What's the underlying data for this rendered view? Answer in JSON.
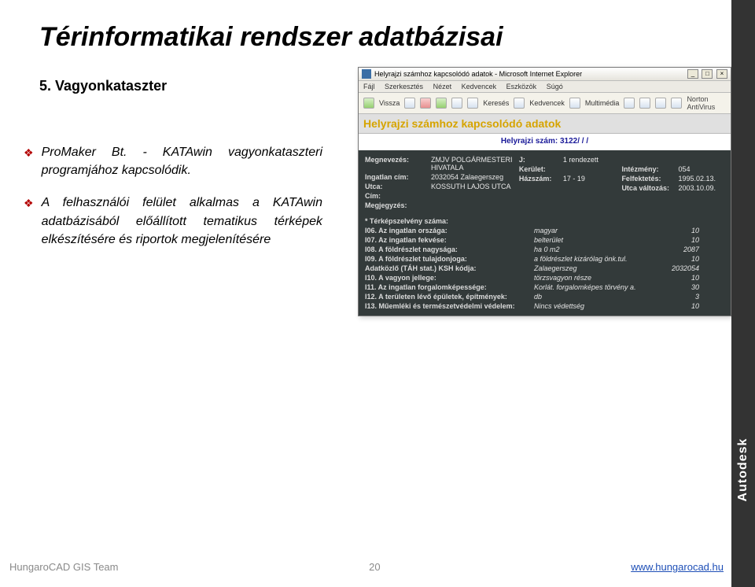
{
  "slide": {
    "title": "Térinformatikai rendszer adatbázisai",
    "subtitle": "5. Vagyonkataszter"
  },
  "bullets": {
    "b1": "ProMaker Bt. - KATAwin vagyonkataszteri programjához kapcsolódik.",
    "b2": "A felhasználói felület alkalmas a KATAwin adatbázisából előállított tematikus térképek elkészítésére és riportok megjelenítésére"
  },
  "browser": {
    "title": "Helyrajzi számhoz kapcsolódó adatok - Microsoft Internet Explorer",
    "menu": {
      "fajl": "Fájl",
      "szerk": "Szerkesztés",
      "nezet": "Nézet",
      "kedv": "Kedvencek",
      "eszk": "Eszközök",
      "sugo": "Súgó"
    },
    "toolbar": {
      "vissza": "Vissza",
      "kereses": "Keresés",
      "kedvencek": "Kedvencek",
      "multimedia": "Multimédia",
      "norton": "Norton AntiVirus"
    }
  },
  "page": {
    "title": "Helyrajzi számhoz kapcsolódó adatok",
    "hrsz_label": "Helyrajzi szám:",
    "hrsz_value": "3122/ / /",
    "megnevezes_l": "Megnevezés:",
    "megnevezes_v": "ZMJV POLGÁRMESTERI HIVATALA",
    "j_l": "J:",
    "j_v": "1   rendezett",
    "ingatlancim_l": "Ingatlan cím:",
    "ingatlancim_v": "2032054   Zalaegerszeg",
    "kerulet_l": "Kerület:",
    "intezmeny_l": "Intézmény:",
    "intezmeny_v": "054",
    "utca_l": "Utca:",
    "utca_v": "KOSSUTH LAJOS UTCA",
    "hazszam_l": "Házszám:",
    "hazszam_v": "17 - 19",
    "felfektetes_l": "Felfektetés:",
    "felfektetes_v": "1995.02.13.",
    "cim_l": "Cím:",
    "valtozas_l": "Utca változás:",
    "valtozas_v": "2003.10.09.",
    "megjegyzes_l": "Megjegyzés:",
    "i_star": "* Térképszelvény száma:",
    "i06_l": "I06. Az ingatlan országa:",
    "i06_v1": "magyar",
    "i06_v2": "10",
    "i07_l": "I07. Az ingatlan fekvése:",
    "i07_v1": "belterület",
    "i07_v2": "10",
    "i08_l": "I08. A földrészlet nagysága:",
    "i08_v1": "ha  0            m2",
    "i08_v2": "2087",
    "i09_l": "I09. A földrészlet tulajdonjoga:",
    "i09_v1": "a földrészlet kizárólag önk.tul.",
    "i09_v2": "10",
    "adat_l": "Adatközlő (TÁH stat.) KSH kódja:",
    "adat_v1": "Zalaegerszeg",
    "adat_v2": "2032054",
    "i10_l": "I10. A vagyon jellege:",
    "i10_v1": "törzsvagyon része",
    "i10_v2": "10",
    "i11_l": "I11. Az ingatlan forgalomképessége:",
    "i11_v1": "Korlát. forgalomképes törvény a.",
    "i11_v2": "30",
    "i12_l": "I12. A területen lévő épületek, építmények:",
    "i12_v1": "db",
    "i12_v2": "3",
    "i13_l": "I13. Műemléki és természetvédelmi védelem:",
    "i13_v1": "Nincs védettség",
    "i13_v2": "10"
  },
  "footer": {
    "left": "HungaroCAD GIS Team",
    "mid": "20",
    "right": "www.hungarocad.hu"
  },
  "brand": "Autodesk"
}
